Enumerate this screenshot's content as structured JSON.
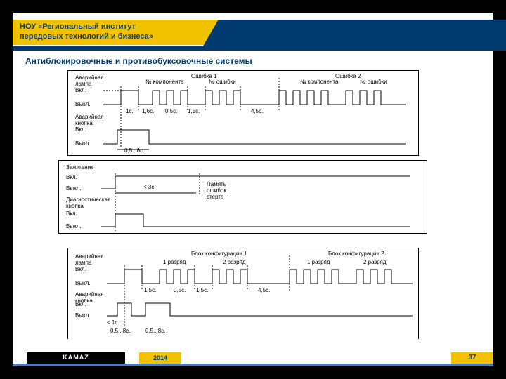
{
  "header": {
    "institute_l1": "НОУ «Региональный институт",
    "institute_l2": "передовых технологий и бизнеса»",
    "subtitle": "Антиблокировочные и противобуксовочные системы"
  },
  "diagram1": {
    "ch1": "Аварийная\nлампа",
    "ch2": "Аварийная\nкнопка",
    "on": "Вкл.",
    "off": "Выкл.",
    "err1": "Ошибка 1",
    "err2": "Ошибка 2",
    "comp": "№ компонента",
    "ecode": "№ ошибки",
    "t": [
      "1с.",
      "1,6с.",
      "0,5с.",
      "1,5с.",
      "4,5с."
    ],
    "bottom": "0,5...8с."
  },
  "diagram2": {
    "ch1": "Зажигание",
    "ch2": "Диагностическая\nкнопка",
    "on": "Вкл.",
    "off": "Выкл.",
    "t": "< 3с.",
    "note": "Память\nошибок\nстерта"
  },
  "diagram3": {
    "ch1": "Аварийная\nлампа",
    "ch2": "Аварийная\nкнопка",
    "on": "Вкл.",
    "off": "Выкл.",
    "b1": "Блок конфигурации 1",
    "b2": "Блок конфигурации 2",
    "d1": "1 разряд",
    "d2": "2 разряд",
    "t": [
      "1,5с.",
      "0,5с.",
      "1,5с.",
      "4,5с."
    ],
    "lt": "< 1с.",
    "bottom": [
      "0,5...8с.",
      "0,5...8с."
    ]
  },
  "footer": {
    "logo": "KAMAZ",
    "year": "2014",
    "page": "37"
  }
}
